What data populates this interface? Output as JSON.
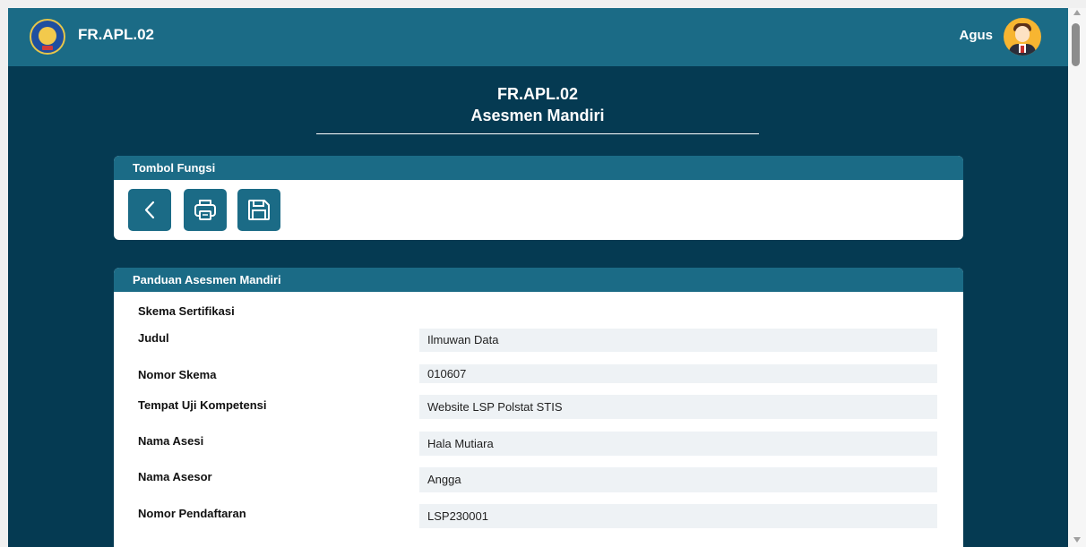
{
  "header": {
    "app_title": "FR.APL.02",
    "user_name": "Agus",
    "logo_icon": "stis-logo",
    "avatar_icon": "user-avatar"
  },
  "page": {
    "title_line1": "FR.APL.02",
    "title_line2": "Asesmen Mandiri"
  },
  "tombol_fungsi": {
    "title": "Tombol Fungsi",
    "buttons": [
      {
        "name": "back",
        "icon": "chevron-left-icon"
      },
      {
        "name": "print",
        "icon": "printer-icon"
      },
      {
        "name": "save",
        "icon": "floppy-disk-icon"
      }
    ]
  },
  "panduan": {
    "title": "Panduan Asesmen Mandiri",
    "section_label": "Skema Sertifikasi",
    "rows": [
      {
        "label": "Judul",
        "value": "Ilmuwan Data"
      },
      {
        "label": "Nomor Skema",
        "value": "010607"
      },
      {
        "label": "Tempat Uji Kompetensi",
        "value": "Website LSP Polstat STIS"
      },
      {
        "label": "Nama Asesi",
        "value": "Hala Mutiara"
      },
      {
        "label": "Nama Asesor",
        "value": "Angga"
      },
      {
        "label": "Nomor Pendaftaran",
        "value": "LSP230001"
      }
    ]
  },
  "colors": {
    "background": "#053a52",
    "header": "#1b6b86",
    "value_field": "#eef2f5"
  }
}
